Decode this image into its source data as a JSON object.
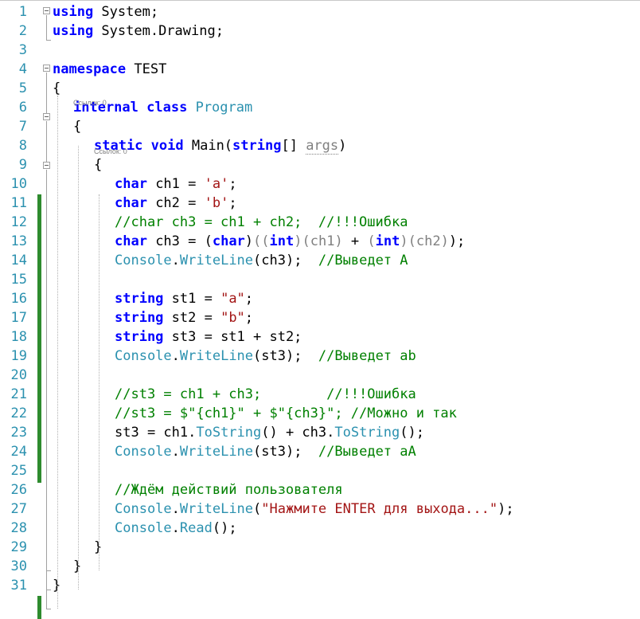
{
  "editor": {
    "reference_hint": "Ссылок: 0",
    "lines": [
      {
        "n": "1",
        "tokens": [
          {
            "t": "using",
            "c": "kw"
          },
          {
            "t": " System;"
          }
        ]
      },
      {
        "n": "2",
        "tokens": [
          {
            "t": "using",
            "c": "kw"
          },
          {
            "t": " System.Drawing;"
          }
        ]
      },
      {
        "n": "3",
        "tokens": []
      },
      {
        "n": "4",
        "tokens": [
          {
            "t": "namespace",
            "c": "kw"
          },
          {
            "t": " TEST"
          }
        ]
      },
      {
        "n": "5",
        "tokens": [
          {
            "t": "{"
          }
        ]
      },
      {
        "n": "6",
        "tokens": [
          {
            "t": "internal",
            "c": "kw"
          },
          {
            "t": " "
          },
          {
            "t": "class",
            "c": "kw"
          },
          {
            "t": " "
          },
          {
            "t": "Program",
            "c": "ty"
          }
        ]
      },
      {
        "n": "7",
        "tokens": [
          {
            "t": "{"
          }
        ]
      },
      {
        "n": "8",
        "tokens": [
          {
            "t": "static",
            "c": "kw"
          },
          {
            "t": " "
          },
          {
            "t": "void",
            "c": "kw"
          },
          {
            "t": " Main("
          },
          {
            "t": "string",
            "c": "kw"
          },
          {
            "t": "[] "
          },
          {
            "t": "args",
            "c": "args"
          },
          {
            "t": ")"
          }
        ]
      },
      {
        "n": "9",
        "tokens": [
          {
            "t": "{"
          }
        ]
      },
      {
        "n": "10",
        "tokens": [
          {
            "t": "char",
            "c": "kw"
          },
          {
            "t": " ch1 = "
          },
          {
            "t": "'a'",
            "c": "str"
          },
          {
            "t": ";"
          }
        ]
      },
      {
        "n": "11",
        "tokens": [
          {
            "t": "char",
            "c": "kw"
          },
          {
            "t": " ch2 = "
          },
          {
            "t": "'b'",
            "c": "str"
          },
          {
            "t": ";"
          }
        ]
      },
      {
        "n": "12",
        "tokens": [
          {
            "t": "//char ch3 = ch1 + ch2;  //!!!Ошибка",
            "c": "cm"
          }
        ]
      },
      {
        "n": "13",
        "tokens": [
          {
            "t": "char",
            "c": "kw"
          },
          {
            "t": " ch3 = ("
          },
          {
            "t": "char",
            "c": "kw"
          },
          {
            "t": ")"
          },
          {
            "t": "((",
            "c": "gr"
          },
          {
            "t": "int",
            "c": "kw"
          },
          {
            "t": ")",
            "c": "gr"
          },
          {
            "t": "(ch1)",
            "c": "gr"
          },
          {
            "t": " + "
          },
          {
            "t": "(",
            "c": "gr"
          },
          {
            "t": "int",
            "c": "kw"
          },
          {
            "t": ")",
            "c": "gr"
          },
          {
            "t": "(ch2)",
            "c": "gr"
          },
          {
            "t": ");"
          }
        ]
      },
      {
        "n": "14",
        "tokens": [
          {
            "t": "Console",
            "c": "ty"
          },
          {
            "t": "."
          },
          {
            "t": "WriteLine",
            "c": "ty"
          },
          {
            "t": "(ch3);  "
          },
          {
            "t": "//Выведет A",
            "c": "cm"
          }
        ]
      },
      {
        "n": "15",
        "tokens": []
      },
      {
        "n": "16",
        "tokens": [
          {
            "t": "string",
            "c": "kw"
          },
          {
            "t": " st1 = "
          },
          {
            "t": "\"a\"",
            "c": "str"
          },
          {
            "t": ";"
          }
        ]
      },
      {
        "n": "17",
        "tokens": [
          {
            "t": "string",
            "c": "kw"
          },
          {
            "t": " st2 = "
          },
          {
            "t": "\"b\"",
            "c": "str"
          },
          {
            "t": ";"
          }
        ]
      },
      {
        "n": "18",
        "tokens": [
          {
            "t": "string",
            "c": "kw"
          },
          {
            "t": " st3 = st1 + st2;"
          }
        ]
      },
      {
        "n": "19",
        "tokens": [
          {
            "t": "Console",
            "c": "ty"
          },
          {
            "t": "."
          },
          {
            "t": "WriteLine",
            "c": "ty"
          },
          {
            "t": "(st3);  "
          },
          {
            "t": "//Выведет ab",
            "c": "cm"
          }
        ]
      },
      {
        "n": "20",
        "tokens": []
      },
      {
        "n": "21",
        "tokens": [
          {
            "t": "//st3 = ch1 + ch3;        //!!!Ошибка",
            "c": "cm"
          }
        ]
      },
      {
        "n": "22",
        "tokens": [
          {
            "t": "//st3 = $\"{ch1}\" + $\"{ch3}\"; //Можно и так",
            "c": "cm"
          }
        ]
      },
      {
        "n": "23",
        "tokens": [
          {
            "t": "st3 = ch1."
          },
          {
            "t": "ToString",
            "c": "ty"
          },
          {
            "t": "() + ch3."
          },
          {
            "t": "ToString",
            "c": "ty"
          },
          {
            "t": "();"
          }
        ]
      },
      {
        "n": "24",
        "tokens": [
          {
            "t": "Console",
            "c": "ty"
          },
          {
            "t": "."
          },
          {
            "t": "WriteLine",
            "c": "ty"
          },
          {
            "t": "(st3);  "
          },
          {
            "t": "//Выведет aA",
            "c": "cm"
          }
        ]
      },
      {
        "n": "25",
        "tokens": []
      },
      {
        "n": "26",
        "tokens": [
          {
            "t": "//Ждём действий пользователя",
            "c": "cm"
          }
        ]
      },
      {
        "n": "27",
        "tokens": [
          {
            "t": "Console",
            "c": "ty"
          },
          {
            "t": "."
          },
          {
            "t": "WriteLine",
            "c": "ty"
          },
          {
            "t": "("
          },
          {
            "t": "\"Нажмите ENTER для выхода...\"",
            "c": "str"
          },
          {
            "t": ");"
          }
        ]
      },
      {
        "n": "28",
        "tokens": [
          {
            "t": "Console",
            "c": "ty"
          },
          {
            "t": "."
          },
          {
            "t": "Read",
            "c": "ty"
          },
          {
            "t": "();"
          }
        ]
      },
      {
        "n": "29",
        "tokens": [
          {
            "t": "}"
          }
        ]
      },
      {
        "n": "30",
        "tokens": [
          {
            "t": "}"
          }
        ]
      },
      {
        "n": "31",
        "tokens": [
          {
            "t": "}"
          }
        ]
      }
    ]
  }
}
